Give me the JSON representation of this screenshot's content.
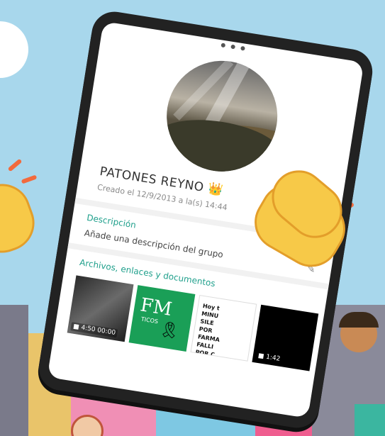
{
  "group": {
    "name": "PATONES REYNO",
    "crown_icon": "👑",
    "created": "Creado el 12/9/2013 a la(s) 14:44"
  },
  "description": {
    "title": "Descripción",
    "placeholder": "Añade una descripción del grupo"
  },
  "media": {
    "title": "Archivos, enlaces y documentos",
    "items": [
      {
        "kind": "video",
        "duration": "4:50",
        "extra": "00:00"
      },
      {
        "kind": "image",
        "text": "FM",
        "subtext": "TICOS"
      },
      {
        "kind": "document",
        "text": "Hoy t\nMINU\nSILE\nPOR\nFARMA\nFALLI\nPOR C"
      },
      {
        "kind": "video",
        "duration": "1:42"
      }
    ]
  },
  "colors": {
    "accent": "#20a08c",
    "background": "#a8d7ec",
    "hand": "#f7c948"
  }
}
